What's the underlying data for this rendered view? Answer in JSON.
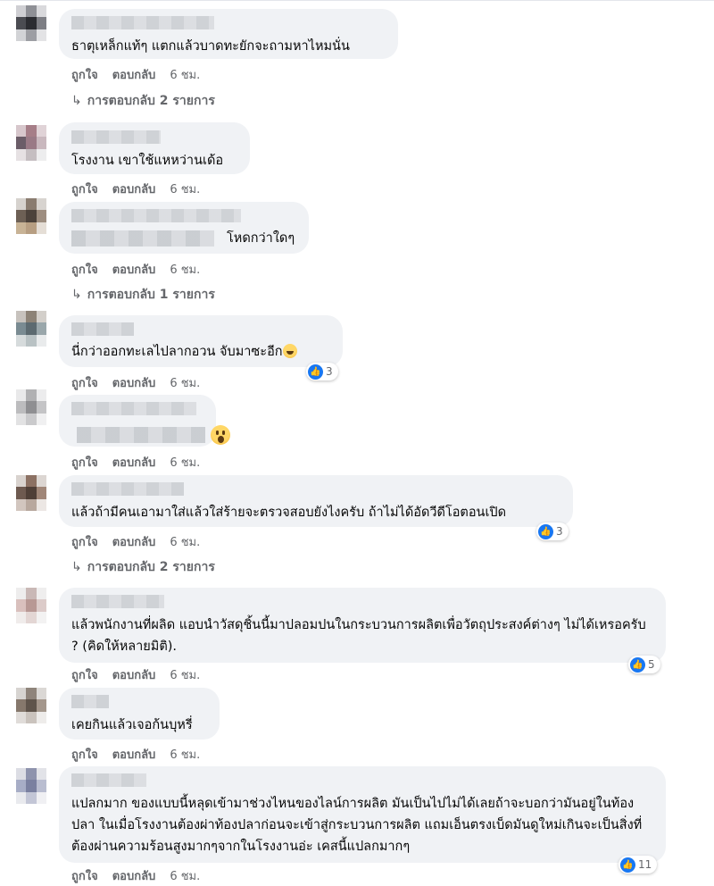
{
  "labels": {
    "like": "ถูกใจ",
    "reply": "ตอบกลับ"
  },
  "colors": {
    "secondary_text": "#65676b",
    "bubble": "#f0f2f5",
    "like_blue": "#1877f2"
  },
  "comments": [
    {
      "text": "ธาตุเหล็กแท้ๆ แตกแล้วบาดทะยักจะถามหาไหมนั่น",
      "time": "6 ชม.",
      "replies": "การตอบกลับ 2 รายการ"
    },
    {
      "text": "โรงงาน เขาใช้แหหว่านเด้อ",
      "time": "6 ชม."
    },
    {
      "text": "โหดกว่าใดๆ",
      "time": "6 ชม.",
      "replies": "การตอบกลับ 1 รายการ"
    },
    {
      "text": "นี่กว่าออกทะเลไปลากอวน จับมาซะอีก",
      "time": "6 ชม.",
      "reaction_count": "3",
      "emoji": "rofl-emoji"
    },
    {
      "text": "",
      "time": "6 ชม.",
      "emoji": "wow-emoji"
    },
    {
      "text": "แล้วถ้ามีคนเอามาใส่แล้วใส่ร้ายจะตรวจสอบยังไงครับ ถ้าไม่ได้อัดวีดีโอตอนเปิด",
      "time": "6 ชม.",
      "reaction_count": "3",
      "replies": "การตอบกลับ 2 รายการ"
    },
    {
      "text": "แล้วพนักงานที่ผลิด แอบนำวัสดุชิ้นนี้มาปลอมปนในกระบวนการผลิตเพื่อวัตถุประสงค์ต่างๆ ไม่ได้เหรอครับ ? (คิดให้หลายมิติ).",
      "time": "6 ชม.",
      "reaction_count": "5"
    },
    {
      "text": "เคยกินแล้วเจอก้นบุหรี่",
      "time": "6 ชม."
    },
    {
      "text": "แปลกมาก ของแบบนี้หลุดเข้ามาช่วงไหนของไลน์การผลิต มันเป็นไปไม่ได้เลยถ้าจะบอกว่ามันอยู่ในท้องปลา ในเมื่อโรงงานต้องผ่าท้องปลาก่อนจะเข้าสู่กระบวนการผลิต แถมเอ็นตรงเบ็ดมันดูใหม่เกินจะเป็นสิ่งที่ต้องผ่านความร้อนสูงมากๆจากในโรงงานอ่ะ เคสนี้แปลกมากๆ",
      "time": "6 ชม.",
      "reaction_count": "11"
    }
  ]
}
